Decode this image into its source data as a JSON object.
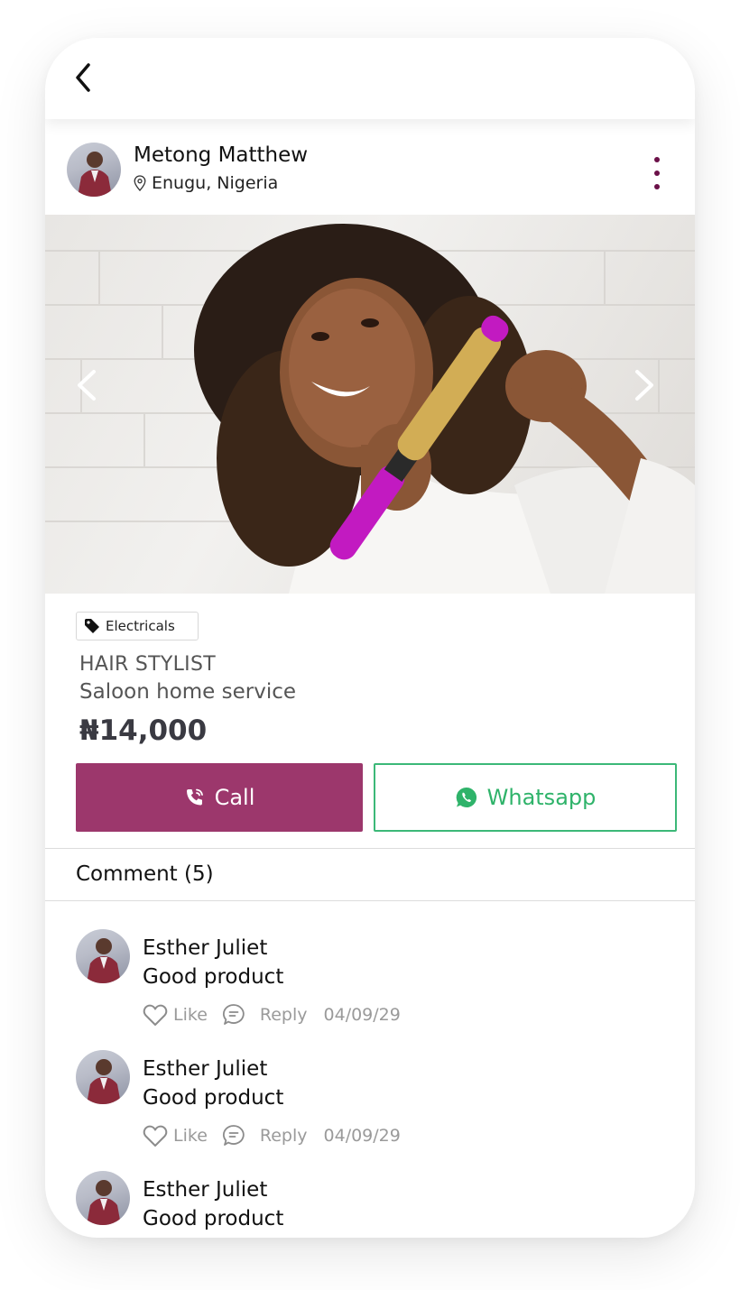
{
  "seller": {
    "name": "Metong Matthew",
    "location": "Enugu, Nigeria"
  },
  "listing": {
    "category": "Electricals",
    "title": "HAIR STYLIST",
    "subtitle": "Saloon home service",
    "price": "₦14,000"
  },
  "actions": {
    "call_label": "Call",
    "whatsapp_label": "Whatsapp"
  },
  "comments_section": {
    "heading": "Comment (5)",
    "like_label": "Like",
    "reply_label": "Reply",
    "items": [
      {
        "author": "Esther Juliet",
        "text": "Good product",
        "date": "04/09/29"
      },
      {
        "author": "Esther Juliet",
        "text": "Good product",
        "date": "04/09/29"
      },
      {
        "author": "Esther Juliet",
        "text": "Good product",
        "date": ""
      }
    ]
  },
  "colors": {
    "brand": "#9c376c",
    "whatsapp": "#2fb36a",
    "more_dots": "#6b1048"
  }
}
